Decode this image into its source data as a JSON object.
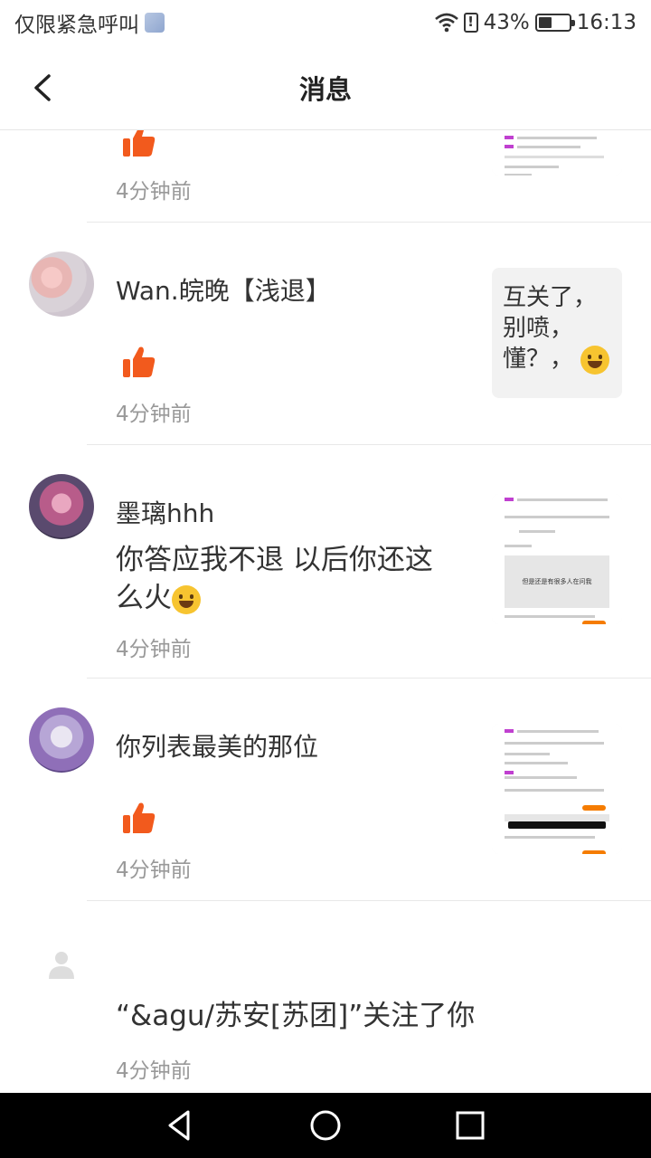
{
  "status_bar": {
    "carrier": "仅限紧急呼叫",
    "battery": "43%",
    "battery_level": 0.43,
    "time": "16:13"
  },
  "header": {
    "back_icon": "chevron-left-icon",
    "title": "消息"
  },
  "messages": [
    {
      "type": "like",
      "time": "4分钟前",
      "has_thumbnail": true
    },
    {
      "type": "like",
      "name": "Wan.皖晚【浅退】",
      "time": "4分钟前",
      "thumbnail_text": "互关了，别喷，懂？，"
    },
    {
      "type": "comment",
      "name": "墨璃hhh",
      "comment": "你答应我不退  以后你还这么火",
      "time": "4分钟前",
      "thumbnail_caption": "但是还是有很多人在问我"
    },
    {
      "type": "like",
      "name": "你列表最美的那位",
      "time": "4分钟前"
    },
    {
      "type": "follow",
      "text": "“&agu/苏安[苏团]”关注了你",
      "time": "4分钟前"
    }
  ],
  "colors": {
    "accent": "#f25a1d",
    "divider": "#e8e8e8",
    "time_text": "#999999"
  }
}
